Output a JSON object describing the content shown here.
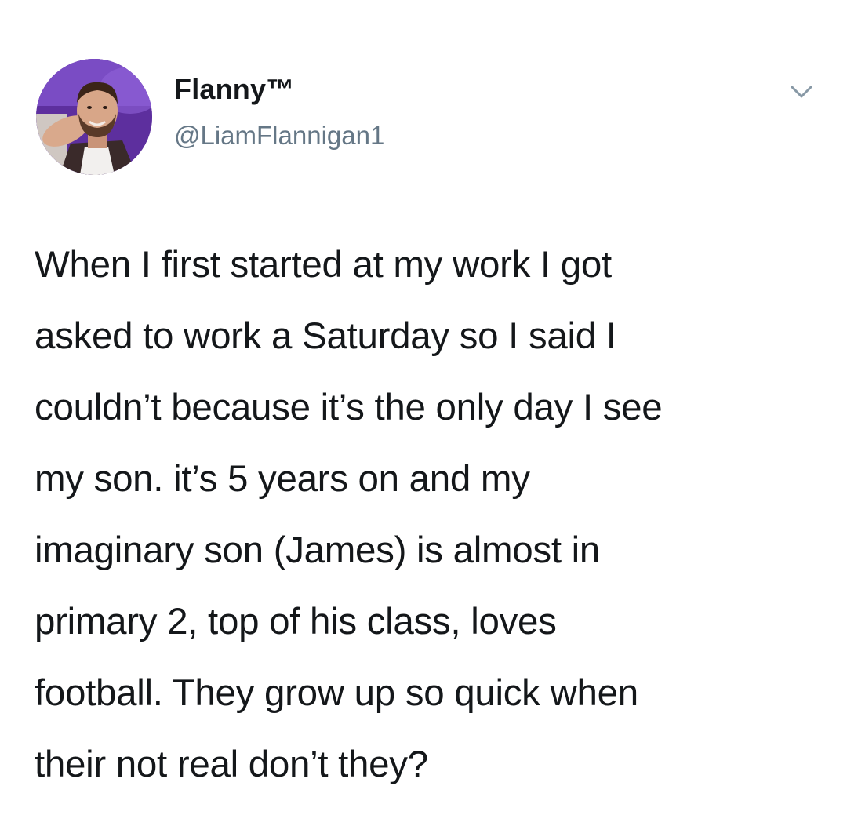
{
  "tweet": {
    "author": {
      "display_name": "Flanny™",
      "handle": "@LiamFlannigan1",
      "avatar_icon": "profile-photo"
    },
    "menu_icon": "chevron-down-icon",
    "text_lines": [
      "When I first started at my work I got",
      "asked to work a Saturday so I said I",
      "couldn’t because it’s the only day I see",
      "my son. it’s 5 years on and my",
      "imaginary son (James) is almost in",
      "primary 2, top of his class, loves",
      "football. They grow up so quick when",
      "their not real don’t they?"
    ]
  },
  "colors": {
    "text": "#14171a",
    "secondary_text": "#657786",
    "chevron": "#8899a6",
    "avatar_background": "#6b3fb0"
  }
}
